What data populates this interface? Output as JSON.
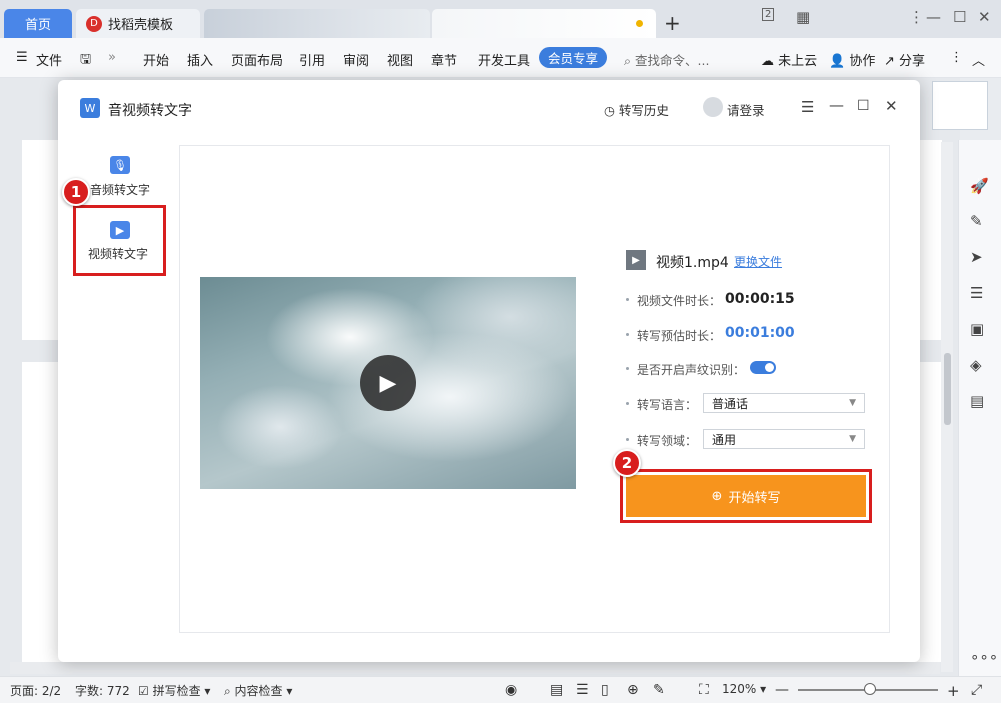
{
  "tabs": {
    "home": "首页",
    "template": "找稻壳模板",
    "template_logo": "D"
  },
  "window_controls": {
    "layout": "2",
    "grid": "▦",
    "menu": "⋮",
    "minimize": "—",
    "maximize": "☐",
    "close": "✕"
  },
  "menubar": {
    "file": "文件",
    "items": [
      "开始",
      "插入",
      "页面布局",
      "引用",
      "审阅",
      "视图",
      "章节",
      "开发工具"
    ],
    "vip": "会员专享",
    "search": "查找命令、...",
    "cloud": "未上云",
    "collab": "协作",
    "share": "分享"
  },
  "dialog": {
    "title": "音视频转文字",
    "logo_text": "W",
    "history": "转写历史",
    "login": "请登录",
    "sidebar": {
      "audio": "音频转文字",
      "video": "视频转文字"
    },
    "badges": {
      "one": "1",
      "two": "2"
    },
    "file": {
      "name": "视频1.mp4",
      "change": "更换文件"
    },
    "info": {
      "duration_label": "视频文件时长：",
      "duration_value": "00:00:15",
      "estimate_label": "转写预估时长：",
      "estimate_value": "00:01:00",
      "voiceprint_label": "是否开启声纹识别：",
      "voiceprint_on": true,
      "language_label": "转写语言：",
      "language_value": "普通话",
      "domain_label": "转写领域：",
      "domain_value": "通用"
    },
    "start_button": "开始转写"
  },
  "statusbar": {
    "page": "页面: 2/2",
    "words": "字数: 772",
    "spell": "拼写检查",
    "content": "内容检查",
    "zoom": "120%"
  },
  "colors": {
    "accent": "#3b7ddd",
    "start_button": "#f7941d",
    "highlight_red": "#d81e1e",
    "tab_active": "#4a86e8"
  }
}
